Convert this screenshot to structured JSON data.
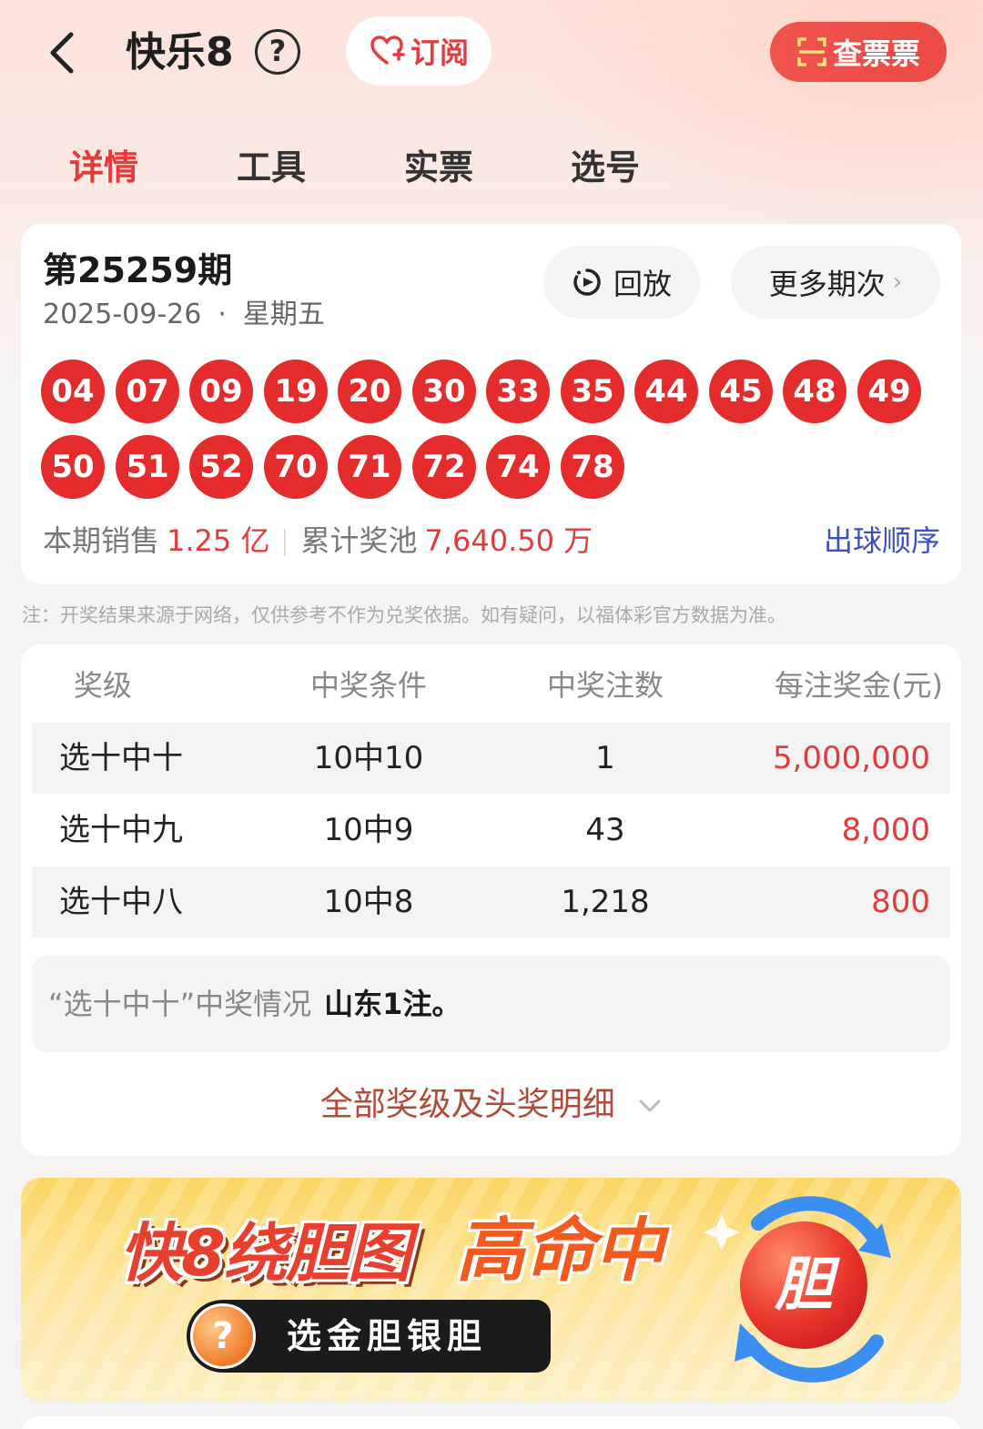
{
  "header": {
    "title": "快乐8",
    "help": "?",
    "subscribe_label": "订阅",
    "check_ticket_label": "查票票"
  },
  "tabs": [
    {
      "label": "详情",
      "active": true
    },
    {
      "label": "工具",
      "active": false
    },
    {
      "label": "实票",
      "active": false
    },
    {
      "label": "选号",
      "active": false
    }
  ],
  "draw": {
    "issue": "第25259期",
    "date": "2025-09-26",
    "weekday": "星期五",
    "replay_label": "回放",
    "more_label": "更多期次",
    "numbers": [
      "04",
      "07",
      "09",
      "19",
      "20",
      "30",
      "33",
      "35",
      "44",
      "45",
      "48",
      "49",
      "50",
      "51",
      "52",
      "70",
      "71",
      "72",
      "74",
      "78"
    ],
    "sales_label": "本期销售",
    "sales_value": "1.25 亿",
    "pool_label": "累计奖池",
    "pool_value": "7,640.50 万",
    "order_label": "出球顺序"
  },
  "note": "注：开奖结果来源于网络，仅供参考不作为兑奖依据。如有疑问，以福体彩官方数据为准。",
  "prize_table": {
    "headers": [
      "奖级",
      "中奖条件",
      "中奖注数",
      "每注奖金(元)"
    ],
    "rows": [
      {
        "level": "选十中十",
        "condition": "10中10",
        "count": "1",
        "amount": "5,000,000"
      },
      {
        "level": "选十中九",
        "condition": "10中9",
        "count": "43",
        "amount": "8,000"
      },
      {
        "level": "选十中八",
        "condition": "10中8",
        "count": "1,218",
        "amount": "800"
      }
    ],
    "win_info_label": "“选十中十”中奖情况",
    "win_info_value": "山东1注。",
    "all_levels_label": "全部奖级及头奖明细"
  },
  "banner": {
    "title1": "快8绕胆图",
    "title2": "高命中",
    "pill": "选金胆银胆",
    "question": "?",
    "ball": "胆"
  },
  "colors": {
    "accent_red": "#e42c2c",
    "link_blue": "#3a4fc0",
    "check_btn": "#ec4a45"
  }
}
